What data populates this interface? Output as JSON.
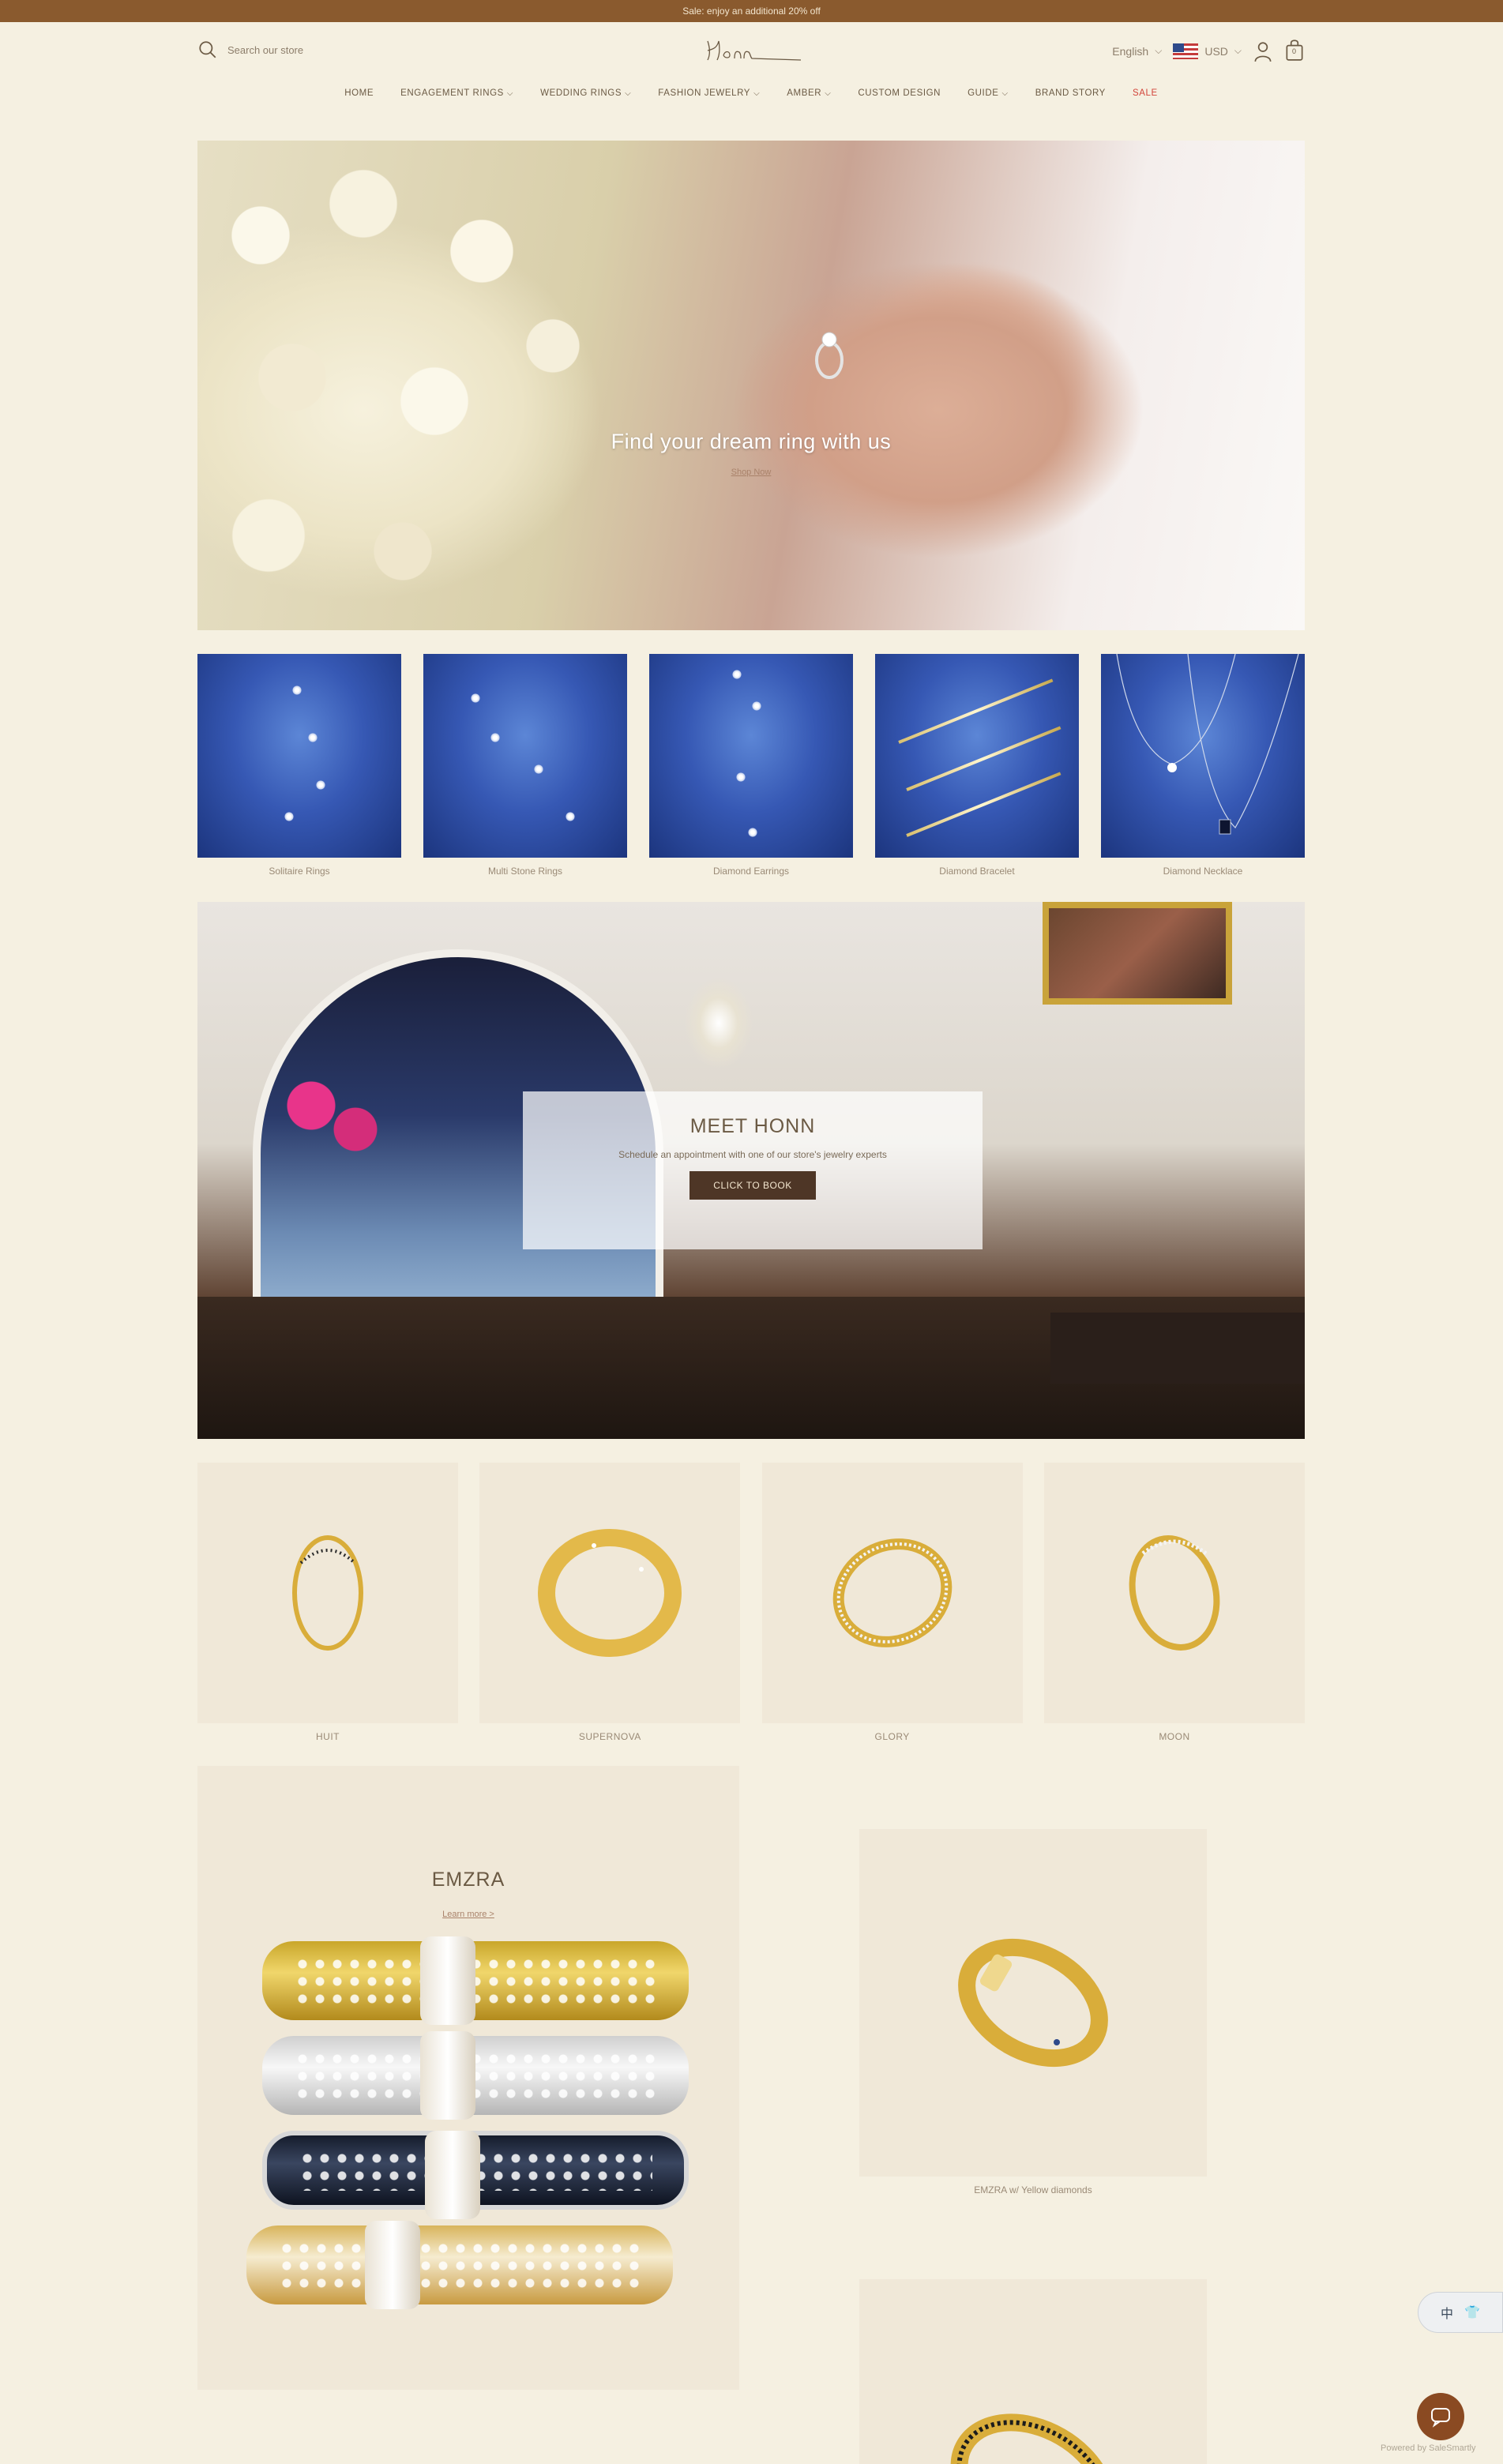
{
  "announcement": "Sale: enjoy an additional 20% off",
  "header": {
    "search_placeholder": "Search our store",
    "language": "English",
    "currency": "USD",
    "cart_count": "0"
  },
  "nav": {
    "items": [
      {
        "label": "HOME"
      },
      {
        "label": "ENGAGEMENT RINGS",
        "chevron": "⌵"
      },
      {
        "label": "WEDDING RINGS",
        "chevron": "⌵"
      },
      {
        "label": "FASHION JEWELRY",
        "chevron": "⌵"
      },
      {
        "label": "AMBER",
        "chevron": "⌵"
      },
      {
        "label": "CUSTOM DESIGN"
      },
      {
        "label": "GUIDE",
        "chevron": "⌵"
      },
      {
        "label": "BRAND STORY"
      },
      {
        "label": "SALE"
      }
    ]
  },
  "hero": {
    "title": "Find your dream ring with us",
    "link": "Shop Now"
  },
  "categories": [
    {
      "label": "Solitaire Rings"
    },
    {
      "label": "Multi Stone Rings"
    },
    {
      "label": "Diamond Earrings"
    },
    {
      "label": "Diamond Bracelet"
    },
    {
      "label": "Diamond Necklace"
    }
  ],
  "meet": {
    "title": "MEET HONN",
    "subtitle": "Schedule an appointment with one of our store's jewelry experts",
    "button": "CLICK TO BOOK"
  },
  "products": [
    {
      "label": "HUIT"
    },
    {
      "label": "SUPERNOVA"
    },
    {
      "label": "GLORY"
    },
    {
      "label": "MOON"
    }
  ],
  "emzra": {
    "title": "EMZRA",
    "link": "Learn more >",
    "product_label": "EMZRA w/ Yellow diamonds"
  },
  "widget": {
    "lang_char": "中",
    "shirt_icon": "👕"
  },
  "powered": "Powered by SaleSmartly",
  "colors": {
    "background": "#f5f0e1",
    "announcement_bar": "#8a5a2e",
    "button": "#4e3626",
    "sale": "#d2443a",
    "chat": "#8a4a22"
  }
}
